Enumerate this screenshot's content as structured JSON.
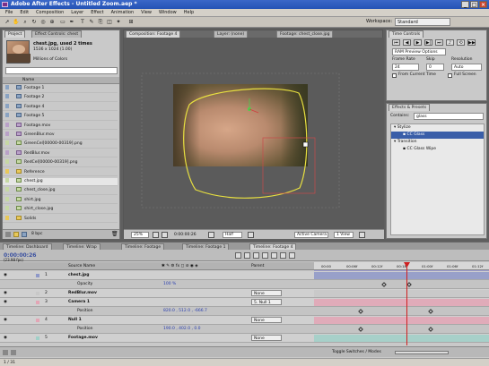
{
  "app": {
    "title": "Adobe After Effects - Untitled Zoom.aep *",
    "menu": [
      "File",
      "Edit",
      "Composition",
      "Layer",
      "Effect",
      "Animation",
      "View",
      "Window",
      "Help"
    ]
  },
  "toolbar": {
    "workspace_label": "Workspace:",
    "workspace_value": "Standard"
  },
  "project": {
    "tabs": [
      "Project",
      "Effect Controls: chest"
    ],
    "item_name": "chest.jpg",
    "item_used": "used 2 times",
    "item_dims": "1536 x 1024 (1.00)",
    "item_colors": "Millions of Colors",
    "column_name": "Name",
    "items": [
      {
        "name": "Footage 1",
        "type": "comp"
      },
      {
        "name": "Footage 2",
        "type": "comp"
      },
      {
        "name": "Footage 4",
        "type": "comp"
      },
      {
        "name": "Footage 5",
        "type": "comp"
      },
      {
        "name": "Footage.mov",
        "type": "avi"
      },
      {
        "name": "GreenBlur.mov",
        "type": "avi"
      },
      {
        "name": "GreenCel[00000-00319].png",
        "type": "img"
      },
      {
        "name": "RedBlur.mov",
        "type": "avi"
      },
      {
        "name": "RedCel[00000-00319].png",
        "type": "img"
      },
      {
        "name": "Reference",
        "type": "folder"
      },
      {
        "name": "chest.jpg",
        "type": "img",
        "selected": true
      },
      {
        "name": "chest_close.jpg",
        "type": "img"
      },
      {
        "name": "shirt.jpg",
        "type": "img"
      },
      {
        "name": "shirt_close.jpg",
        "type": "img"
      },
      {
        "name": "Solids",
        "type": "folder"
      }
    ],
    "bpc": "8 bpc"
  },
  "viewer": {
    "tabs": [
      "Composition: Footage 4",
      "Layer: (none)",
      "Footage: chest_close.jpg"
    ],
    "zoom": "25%",
    "timecode": "0:00:00:26",
    "resolution": "Half",
    "camera": "Active Camera",
    "views": "1 View"
  },
  "time_controls": {
    "tab": "Time Controls",
    "ram_preview": "RAM Preview Options",
    "frame_rate_label": "Frame Rate",
    "skip_label": "Skip",
    "resolution_label": "Resolution",
    "frame_rate": "24",
    "skip": "0",
    "resolution": "Auto",
    "from_current": "From Current Time",
    "full_screen": "Full Screen"
  },
  "effects": {
    "tab": "Effects & Presets",
    "contains_label": "Contains:",
    "search": "glass",
    "tree": [
      {
        "label": "Stylize",
        "indent": 0
      },
      {
        "label": "CC Glass",
        "indent": 1,
        "selected": true
      },
      {
        "label": "Transition",
        "indent": 0
      },
      {
        "label": "CC Glass Wipe",
        "indent": 1
      }
    ]
  },
  "timeline": {
    "tabs": [
      "Timeline: Dashboard",
      "Timeline: Wrap",
      "Timeline: Footage",
      "Timeline: Footage 1",
      "Timeline: Footage 4"
    ],
    "timecode": "0:00:00:26",
    "fps": "(23.98 fps)",
    "col_source": "Source Name",
    "col_parent": "Parent",
    "ruler": [
      "00:00",
      "00:06f",
      "00:12f",
      "00:18f",
      "01:00f",
      "01:06f",
      "01:12f"
    ],
    "layers": [
      {
        "num": "1",
        "name": "chest.jpg",
        "bold": true,
        "parent": "",
        "color": "#8e98c8"
      },
      {
        "num": "",
        "name": "Opacity",
        "value": "100 %",
        "parent": "",
        "color": ""
      },
      {
        "num": "2",
        "name": "RedBlur.mov",
        "bold": true,
        "parent": "None",
        "color": "#c8c8c8"
      },
      {
        "num": "3",
        "name": "Camera 1",
        "bold": true,
        "parent": "5. Null 1",
        "color": "#e3a5b5"
      },
      {
        "num": "",
        "name": "Position",
        "value": "820.0 , 512.0 , -666.7",
        "parent": "",
        "color": ""
      },
      {
        "num": "4",
        "name": "Null 1",
        "bold": true,
        "parent": "None",
        "color": "#e3a5b5"
      },
      {
        "num": "",
        "name": "Position",
        "value": "190.0 , 402.0 , 0.0",
        "parent": "",
        "color": ""
      },
      {
        "num": "5",
        "name": "Footage.mov",
        "bold": true,
        "parent": "None",
        "color": "#a0d0c8"
      }
    ],
    "toggle_label": "Toggle Switches / Modes"
  },
  "status": {
    "text": "1 / 31"
  },
  "colors": {
    "panel": "#c9c9c9",
    "accent": "#2453b5",
    "playhead": "#d02020",
    "mask": "#e8e040"
  }
}
